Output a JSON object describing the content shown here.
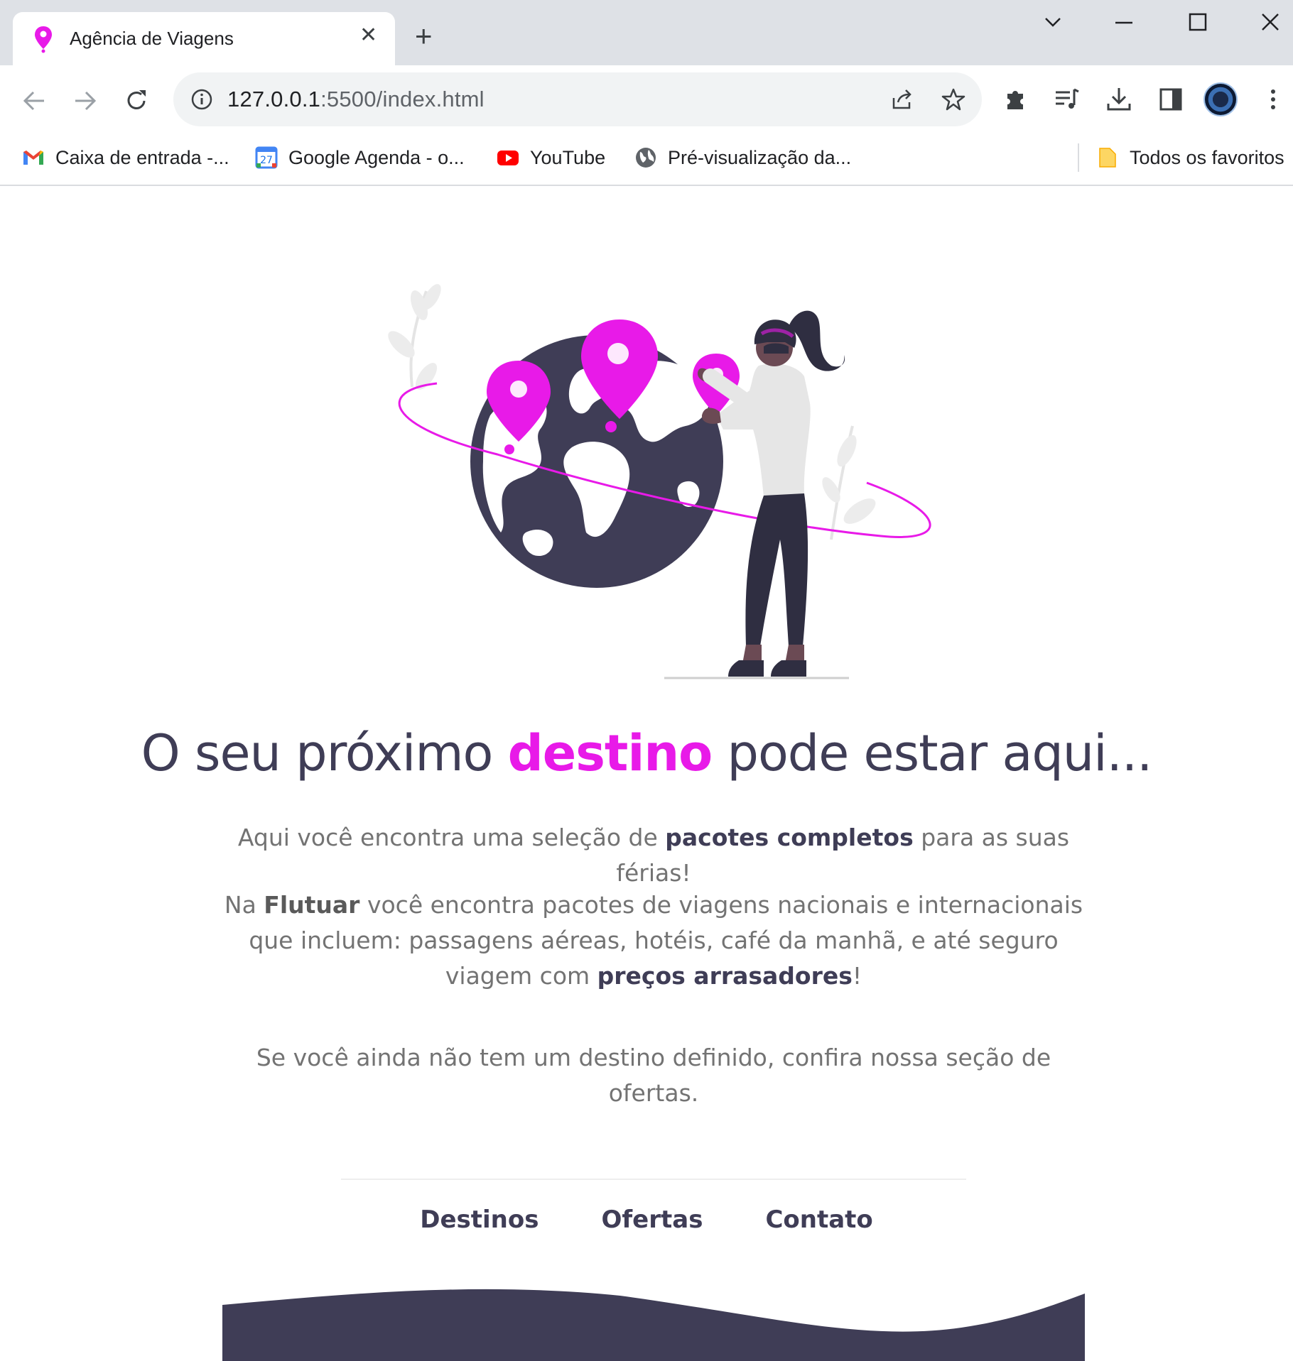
{
  "browser": {
    "tab": {
      "title": "Agência de Viagens",
      "close_glyph": "✕"
    },
    "new_tab_glyph": "+",
    "address_bar": {
      "url_host": "127.0.0.1",
      "url_rest": ":5500/index.html"
    },
    "bookmarks": [
      {
        "label": "Caixa de entrada -...",
        "icon": "gmail-icon"
      },
      {
        "label": "Google Agenda - o...",
        "icon": "calendar-icon",
        "icon_text": "27"
      },
      {
        "label": "YouTube",
        "icon": "youtube-icon"
      },
      {
        "label": "Pré-visualização da...",
        "icon": "globe-icon"
      }
    ],
    "all_bookmarks": {
      "label": "Todos os favoritos",
      "icon": "folder-icon"
    }
  },
  "colors": {
    "accent": "#e81ae8",
    "dark": "#3f3d56",
    "text_grey": "#737373"
  },
  "hero": {
    "headline_before": "O seu próximo ",
    "headline_accent": "destino",
    "headline_after": " pode estar aqui..."
  },
  "intro": {
    "p1_before": "Aqui você encontra uma seleção de ",
    "p1_bold": "pacotes completos",
    "p1_after": " para as suas férias!",
    "p2_before": "Na ",
    "p2_brand": "Flutuar",
    "p2_middle": " você encontra pacotes de viagens nacionais e internacionais que incluem: passagens aéreas, hotéis, café da manhã, e até seguro viagem com ",
    "p2_bold": "preços arrasadores",
    "p2_after": "!",
    "p3": "Se você ainda não tem um destino definido, confira nossa seção de ofertas."
  },
  "nav": {
    "items": [
      {
        "label": "Destinos"
      },
      {
        "label": "Ofertas"
      },
      {
        "label": "Contato"
      }
    ]
  }
}
